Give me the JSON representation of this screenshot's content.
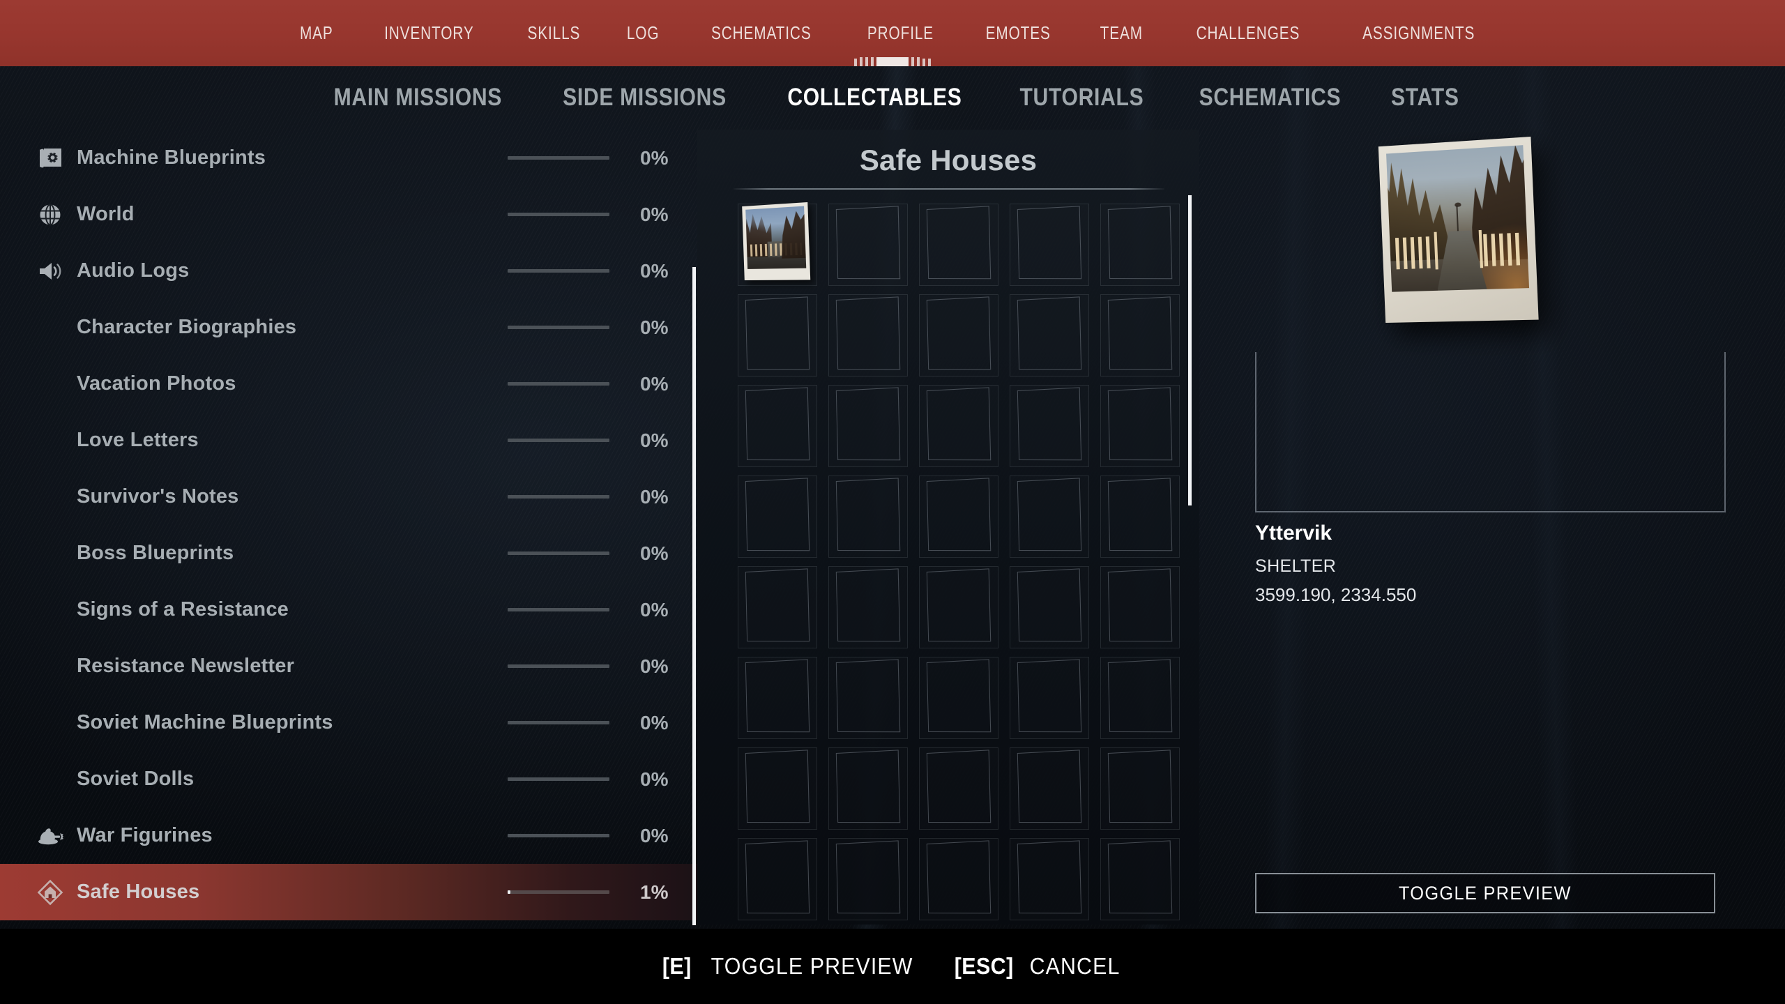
{
  "topnav": {
    "items": [
      {
        "label": "MAP",
        "name": "map"
      },
      {
        "label": "INVENTORY",
        "name": "inventory"
      },
      {
        "label": "SKILLS",
        "name": "skills"
      },
      {
        "label": "LOG",
        "name": "log"
      },
      {
        "label": "SCHEMATICS",
        "name": "schematics"
      },
      {
        "label": "PROFILE",
        "name": "profile"
      },
      {
        "label": "EMOTES",
        "name": "emotes"
      },
      {
        "label": "TEAM",
        "name": "team"
      },
      {
        "label": "CHALLENGES",
        "name": "challenges"
      },
      {
        "label": "ASSIGNMENTS",
        "name": "assignments"
      }
    ],
    "accent_color": "#97362e"
  },
  "subtabs": {
    "items": [
      {
        "label": "MAIN MISSIONS",
        "active": false
      },
      {
        "label": "SIDE MISSIONS",
        "active": false
      },
      {
        "label": "COLLECTABLES",
        "active": true
      },
      {
        "label": "TUTORIALS",
        "active": false
      },
      {
        "label": "SCHEMATICS",
        "active": false
      },
      {
        "label": "STATS",
        "active": false
      }
    ],
    "active_color": "#ffffff",
    "inactive_color": "#9ea6ab"
  },
  "sidebar": {
    "items": [
      {
        "label": "Machine Blueprints",
        "percent": "0%",
        "fill": 0,
        "icon": "blueprint-gear-icon",
        "sub": false,
        "selected": false
      },
      {
        "label": "World",
        "percent": "0%",
        "fill": 0,
        "icon": "globe-icon",
        "sub": false,
        "selected": false
      },
      {
        "label": "Audio Logs",
        "percent": "0%",
        "fill": 0,
        "icon": "speaker-icon",
        "sub": false,
        "selected": false
      },
      {
        "label": "Character Biographies",
        "percent": "0%",
        "fill": 0,
        "icon": null,
        "sub": true,
        "selected": false
      },
      {
        "label": "Vacation Photos",
        "percent": "0%",
        "fill": 0,
        "icon": null,
        "sub": true,
        "selected": false
      },
      {
        "label": "Love Letters",
        "percent": "0%",
        "fill": 0,
        "icon": null,
        "sub": true,
        "selected": false
      },
      {
        "label": "Survivor's Notes",
        "percent": "0%",
        "fill": 0,
        "icon": null,
        "sub": true,
        "selected": false
      },
      {
        "label": "Boss Blueprints",
        "percent": "0%",
        "fill": 0,
        "icon": null,
        "sub": true,
        "selected": false
      },
      {
        "label": "Signs of a Resistance",
        "percent": "0%",
        "fill": 0,
        "icon": null,
        "sub": true,
        "selected": false
      },
      {
        "label": "Resistance Newsletter",
        "percent": "0%",
        "fill": 0,
        "icon": null,
        "sub": true,
        "selected": false
      },
      {
        "label": "Soviet Machine Blueprints",
        "percent": "0%",
        "fill": 0,
        "icon": null,
        "sub": true,
        "selected": false
      },
      {
        "label": "Soviet Dolls",
        "percent": "0%",
        "fill": 0,
        "icon": null,
        "sub": true,
        "selected": false
      },
      {
        "label": "War Figurines",
        "percent": "0%",
        "fill": 0,
        "icon": "war-figurine-icon",
        "sub": false,
        "selected": false
      },
      {
        "label": "Safe Houses",
        "percent": "1%",
        "fill": 3,
        "icon": "safe-house-icon",
        "sub": false,
        "selected": true
      }
    ],
    "selected_highlight_color": "#9d3b33"
  },
  "center": {
    "title": "Safe Houses",
    "grid": {
      "columns": 5,
      "rows": 8,
      "cells": [
        {
          "filled": true,
          "name": "Yttervik"
        },
        {
          "filled": false
        },
        {
          "filled": false
        },
        {
          "filled": false
        },
        {
          "filled": false
        },
        {
          "filled": false
        },
        {
          "filled": false
        },
        {
          "filled": false
        },
        {
          "filled": false
        },
        {
          "filled": false
        },
        {
          "filled": false
        },
        {
          "filled": false
        },
        {
          "filled": false
        },
        {
          "filled": false
        },
        {
          "filled": false
        },
        {
          "filled": false
        },
        {
          "filled": false
        },
        {
          "filled": false
        },
        {
          "filled": false
        },
        {
          "filled": false
        },
        {
          "filled": false
        },
        {
          "filled": false
        },
        {
          "filled": false
        },
        {
          "filled": false
        },
        {
          "filled": false
        },
        {
          "filled": false
        },
        {
          "filled": false
        },
        {
          "filled": false
        },
        {
          "filled": false
        },
        {
          "filled": false
        },
        {
          "filled": false
        },
        {
          "filled": false
        },
        {
          "filled": false
        },
        {
          "filled": false
        },
        {
          "filled": false
        },
        {
          "filled": false
        },
        {
          "filled": false
        },
        {
          "filled": false
        },
        {
          "filled": false
        },
        {
          "filled": false
        }
      ]
    }
  },
  "detail": {
    "name": "Yttervik",
    "type": "SHELTER",
    "coordinates": "3599.190, 2334.550",
    "toggle_preview_label": "TOGGLE PREVIEW"
  },
  "bottombar": {
    "hints": [
      {
        "key": "[E]",
        "action": "TOGGLE PREVIEW"
      },
      {
        "key": "[ESC]",
        "action": "CANCEL"
      }
    ]
  }
}
